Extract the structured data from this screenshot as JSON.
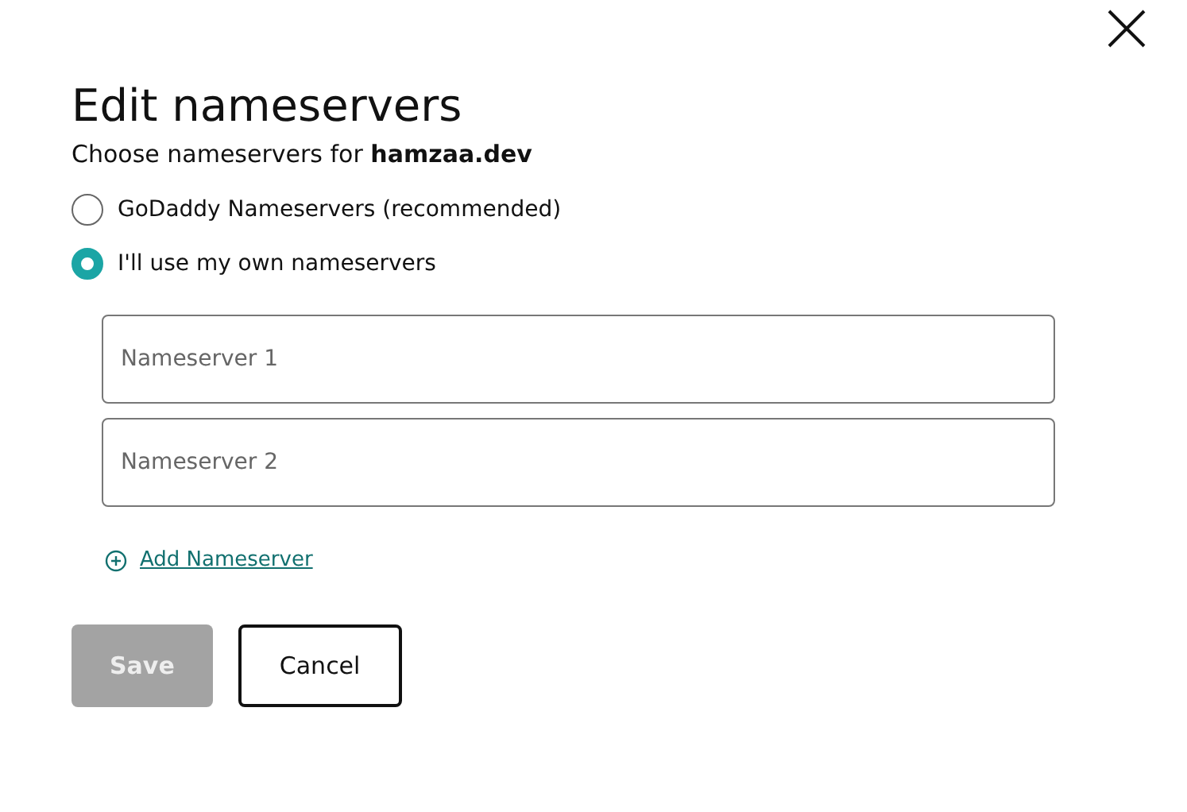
{
  "dialog": {
    "title": "Edit nameservers",
    "subtitle": "Choose nameservers for **hamzaa.dev**"
  },
  "options": [
    {
      "label": "GoDaddy Nameservers (recommended)",
      "selected": false
    },
    {
      "label": "I'll use my own nameservers",
      "selected": true
    }
  ],
  "fields": [
    {
      "placeholder": "Nameserver 1"
    },
    {
      "placeholder": "Nameserver 2"
    }
  ],
  "add_link": "Add Nameserver",
  "buttons": [
    {
      "label": "Save",
      "disabled": true
    },
    {
      "label": "Cancel",
      "disabled": false
    }
  ]
}
